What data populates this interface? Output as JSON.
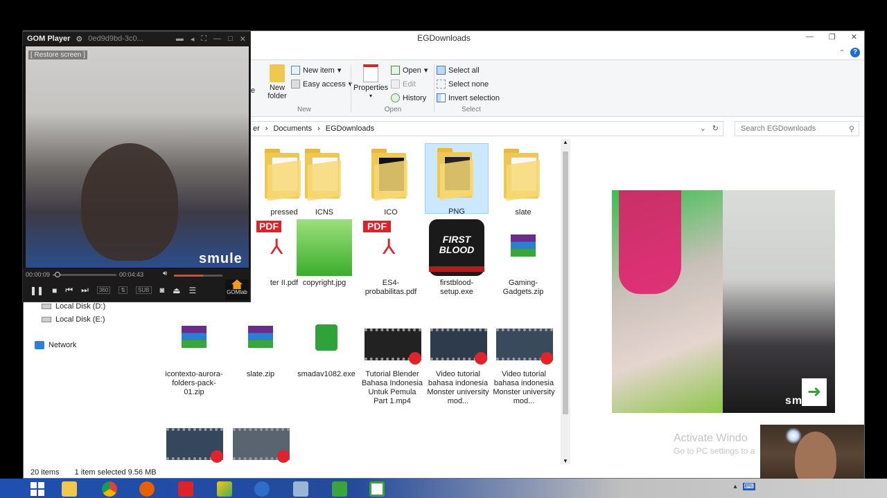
{
  "explorer": {
    "title": "EGDownloads",
    "ribbon": {
      "new_group": {
        "label": "New",
        "new_folder": "New\nfolder",
        "new_item": "New item",
        "easy_access": "Easy access"
      },
      "open_group": {
        "label": "Open",
        "properties": "Properties",
        "open": "Open",
        "edit": "Edit",
        "history": "History"
      },
      "select_group": {
        "label": "Select",
        "select_all": "Select all",
        "select_none": "Select none",
        "invert_selection": "Invert selection"
      },
      "cut_label": "e"
    },
    "breadcrumb": [
      "er",
      "Documents",
      "EGDownloads"
    ],
    "search_placeholder": "Search EGDownloads",
    "nav": {
      "drive_d": "Local Disk (D:)",
      "drive_e": "Local Disk (E:)",
      "network": "Network"
    },
    "files": [
      {
        "name": "pressed",
        "type": "folder"
      },
      {
        "name": "ICNS",
        "type": "folder"
      },
      {
        "name": "ICO",
        "type": "folder"
      },
      {
        "name": "PNG",
        "type": "folder",
        "selected": true
      },
      {
        "name": "slate",
        "type": "folder"
      },
      {
        "name": "ter II.pdf",
        "type": "pdf"
      },
      {
        "name": "copyright.jpg",
        "type": "jpg"
      },
      {
        "name": "ES4-probabilitas.pdf",
        "type": "pdf"
      },
      {
        "name": "firstblood-setup.exe",
        "type": "exe"
      },
      {
        "name": "Gaming-Gadgets.zip",
        "type": "zip"
      },
      {
        "name": "icontexto-aurora-folders-pack-01.zip",
        "type": "zip"
      },
      {
        "name": "slate.zip",
        "type": "zip"
      },
      {
        "name": "smadav1082.exe",
        "type": "exe"
      },
      {
        "name": "Tutorial Blender Bahasa Indonesia Untuk Pemula Part 1.mp4",
        "type": "video"
      },
      {
        "name": "Video tutorial bahasa indonesia Monster university mod...",
        "type": "video"
      },
      {
        "name": "Video tutorial bahasa indonesia Monster university mod...",
        "type": "video"
      },
      {
        "name": "",
        "type": "video"
      },
      {
        "name": "",
        "type": "video"
      }
    ],
    "thumb_labels": {
      "pdf": "PDF",
      "firstblood": "FIRST BLOOD"
    },
    "status": {
      "count": "20 items",
      "selected": "1 item selected  9.56 MB"
    },
    "activate": {
      "line1": "Activate Windo",
      "line2": "Go to PC settings to a"
    },
    "preview_brand": "sm"
  },
  "gom": {
    "brand": "GOM Player",
    "filename": "0ed9d9bd-3c0...",
    "restore": "[ Restore screen ]",
    "smule": "smule",
    "time_current": "00:00:09",
    "time_total": "00:04:43",
    "progress": 0.03,
    "volume": 0.6,
    "sub_label": "SUB",
    "gomlab": "GOMlab"
  },
  "colors": {
    "selection": "#cce8ff",
    "taskbar_blue": "#244a9a",
    "pdf_red": "#d9242a",
    "zip_purple": "#6a2c8c",
    "gom_orange": "#e04a1d"
  }
}
